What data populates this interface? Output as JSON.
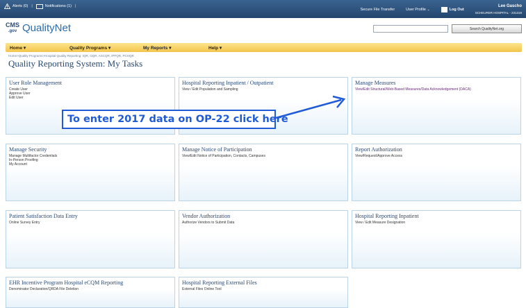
{
  "topbar": {
    "alerts": "Alerts (0)",
    "notifications": "Notifications (1)",
    "secure_transfer": "Secure File Transfer",
    "user_profile": "User Profile",
    "logout": "Log Out",
    "user_name": "Lee Gascho",
    "hospital": "SCHEURER HOSPITAL - 231319"
  },
  "header": {
    "logo_cms": "CMS",
    "logo_gov": ".gov",
    "logo_text": "QualityNet",
    "search_placeholder": "",
    "search_button": "Search QualityNet.org"
  },
  "nav": {
    "home": "Home ▾",
    "quality_programs": "Quality Programs ▾",
    "my_reports": "My Reports ▾",
    "help": "Help ▾"
  },
  "breadcrumb": "Home>Quality Programs>Hospital Quality Reporting: IQR, OQR, ASCQR, IPFQR, PCHQR",
  "page_title": "Quality Reporting System: My Tasks",
  "cards": [
    {
      "title": "User Role Management",
      "links": [
        "Create User",
        "Approve User",
        "Edit User"
      ]
    },
    {
      "title": "Hospital Reporting Inpatient / Outpatient",
      "links": [
        "View / Edit Population and Sampling"
      ]
    },
    {
      "title": "Manage Measures",
      "links": [
        "View/Edit Structural/Web-Based Measures/Data Acknowledgement (DACA)"
      ]
    },
    {
      "title": "Manage Security",
      "links": [
        "Manage Multifactor Credentials",
        "In-Person Proofing",
        "My Account"
      ]
    },
    {
      "title": "Manage Notice of Participation",
      "links": [
        "View/Edit Notice of Participation, Contacts, Campuses"
      ]
    },
    {
      "title": "Report Authorization",
      "links": [
        "View/Request/Approve Access"
      ]
    },
    {
      "title": "Patient Satisfaction Data Entry",
      "links": [
        "Online Survey Entry"
      ]
    },
    {
      "title": "Vendor Authorization",
      "links": [
        "Authorize Vendors to Submit Data"
      ]
    },
    {
      "title": "Hospital Reporting Inpatient",
      "links": [
        "View / Edit Measure Designation"
      ]
    },
    {
      "title": "EHR Incentive Program Hospital eCQM Reporting",
      "links": [
        "Denominator Declaration/QRDA File Deletion"
      ]
    },
    {
      "title": "Hospital Reporting External Files",
      "links": [
        "External Files Online Tool"
      ]
    }
  ],
  "callout": "To enter 2017 data on OP-22 click here",
  "colors": {
    "accent": "#1f5bd6",
    "topbar": "#2d5580",
    "nav": "#f7d56a",
    "card_title": "#2a4872"
  }
}
